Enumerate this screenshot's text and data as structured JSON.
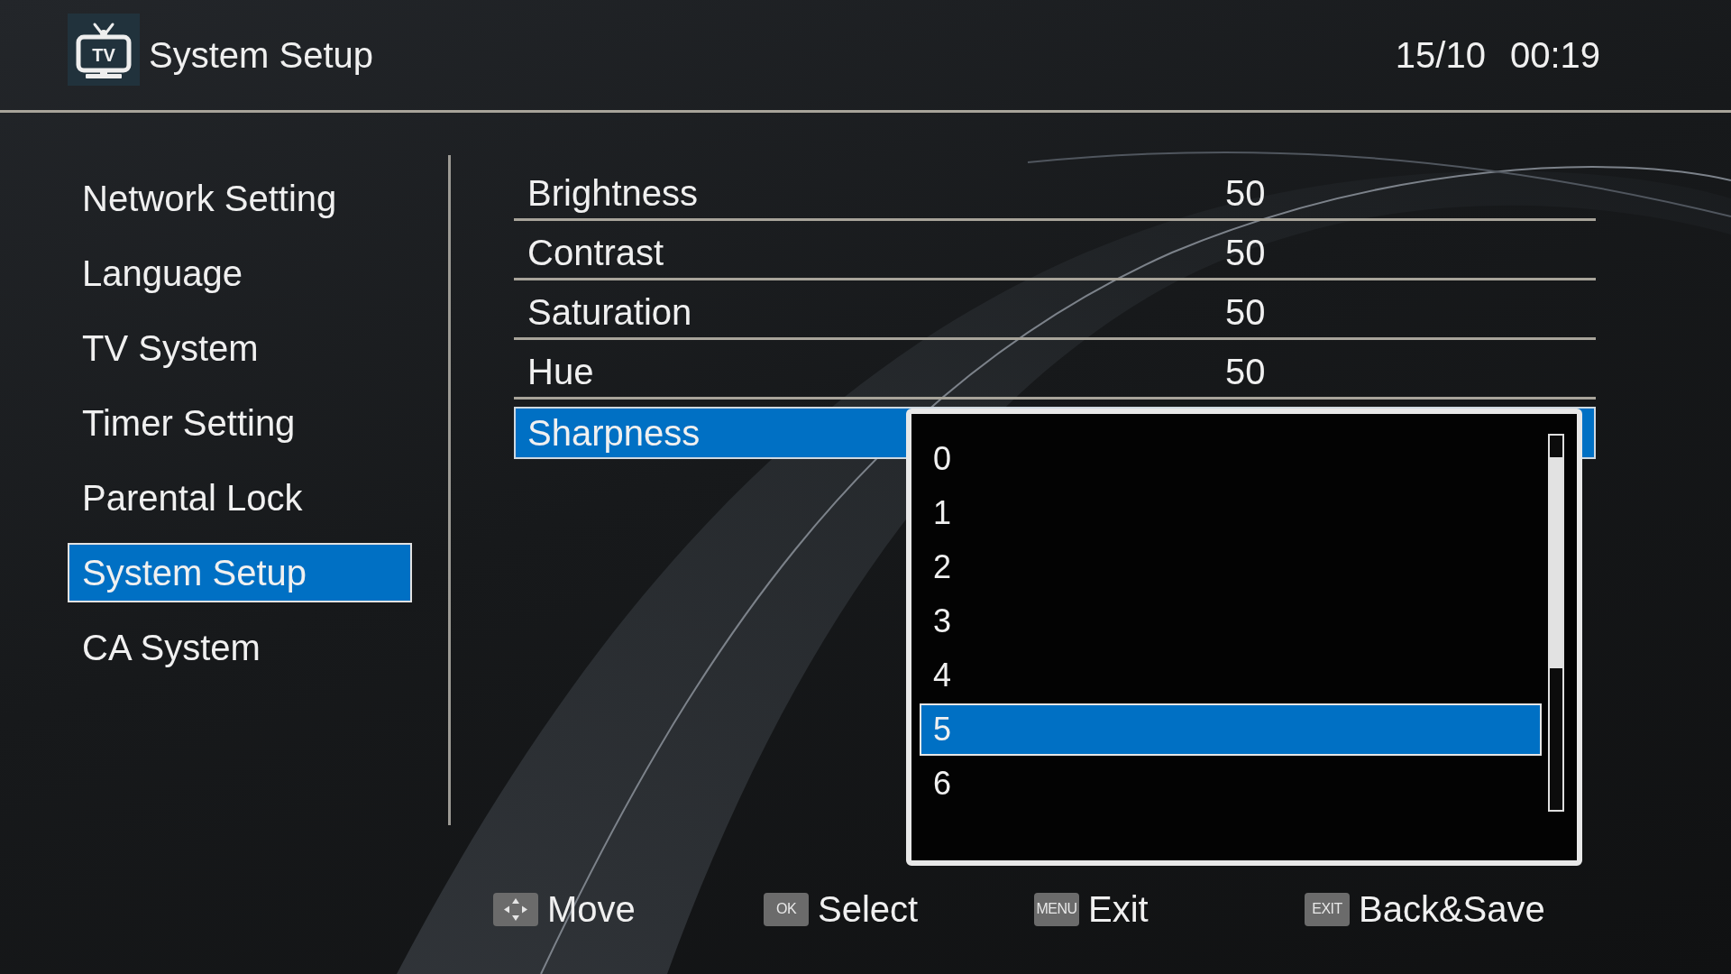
{
  "header": {
    "logo_text": "TV",
    "title": "System Setup",
    "date": "15/10",
    "time": "00:19"
  },
  "sidebar": {
    "items": [
      {
        "label": "Network Setting",
        "selected": false
      },
      {
        "label": "Language",
        "selected": false
      },
      {
        "label": "TV System",
        "selected": false
      },
      {
        "label": "Timer Setting",
        "selected": false
      },
      {
        "label": "Parental Lock",
        "selected": false
      },
      {
        "label": "System Setup",
        "selected": true
      },
      {
        "label": "CA System",
        "selected": false
      }
    ]
  },
  "settings": {
    "rows": [
      {
        "label": "Brightness",
        "value": "50",
        "selected": false
      },
      {
        "label": "Contrast",
        "value": "50",
        "selected": false
      },
      {
        "label": "Saturation",
        "value": "50",
        "selected": false
      },
      {
        "label": "Hue",
        "value": "50",
        "selected": false
      },
      {
        "label": "Sharpness",
        "selected": true
      }
    ]
  },
  "dropdown": {
    "options": [
      {
        "label": "0",
        "selected": false
      },
      {
        "label": "1",
        "selected": false
      },
      {
        "label": "2",
        "selected": false
      },
      {
        "label": "3",
        "selected": false
      },
      {
        "label": "4",
        "selected": false
      },
      {
        "label": "5",
        "selected": true
      },
      {
        "label": "6",
        "selected": false
      }
    ]
  },
  "footer": {
    "hints": [
      {
        "kind": "dpad",
        "label": "Move"
      },
      {
        "kind": "key",
        "key": "OK",
        "label": "Select"
      },
      {
        "kind": "key",
        "key": "MENU",
        "label": "Exit"
      },
      {
        "kind": "key",
        "key": "EXIT",
        "label": "Back&Save"
      }
    ]
  }
}
